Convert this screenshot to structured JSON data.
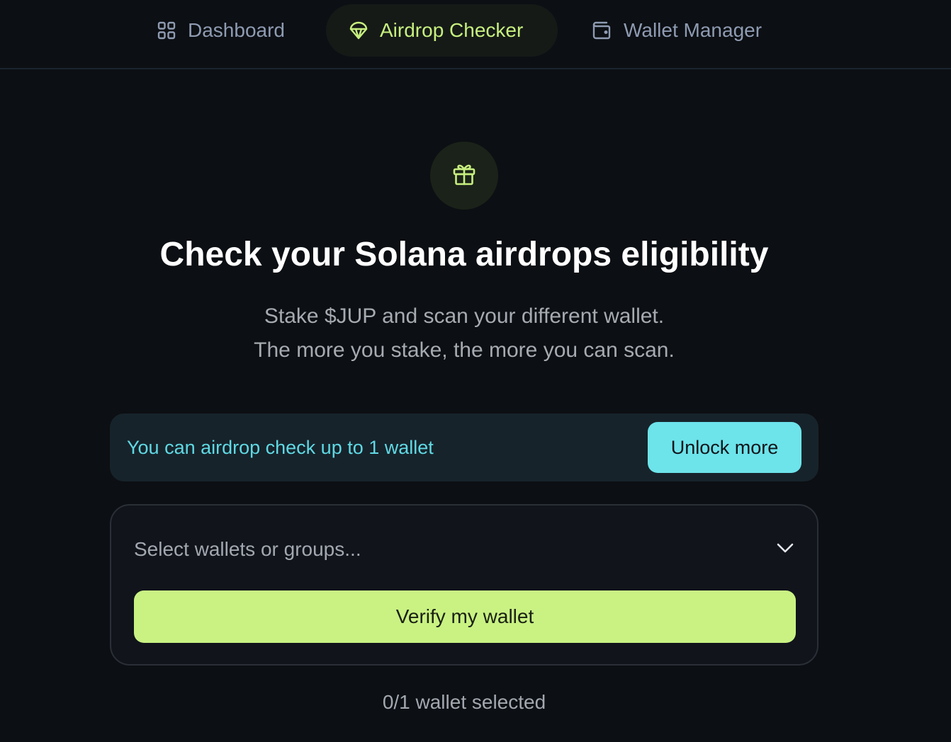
{
  "nav": {
    "items": [
      {
        "label": "Dashboard",
        "icon": "grid-icon"
      },
      {
        "label": "Airdrop Checker",
        "icon": "parachute-icon",
        "active": true
      },
      {
        "label": "Wallet Manager",
        "icon": "wallet-icon"
      }
    ]
  },
  "hero": {
    "icon": "gift-icon",
    "title": "Check your Solana airdrops eligibility",
    "subtitle_line1": "Stake $JUP and scan your different wallet.",
    "subtitle_line2": "The more you stake, the more you can scan."
  },
  "limit": {
    "text": "You can airdrop check up to 1 wallet",
    "button_label": "Unlock more"
  },
  "selector": {
    "placeholder": "Select wallets or groups...",
    "verify_label": "Verify my wallet",
    "count_text": "0/1 wallet selected"
  },
  "colors": {
    "accent_green": "#c9f283",
    "accent_cyan": "#6de3ea",
    "background": "#0c0f13"
  }
}
